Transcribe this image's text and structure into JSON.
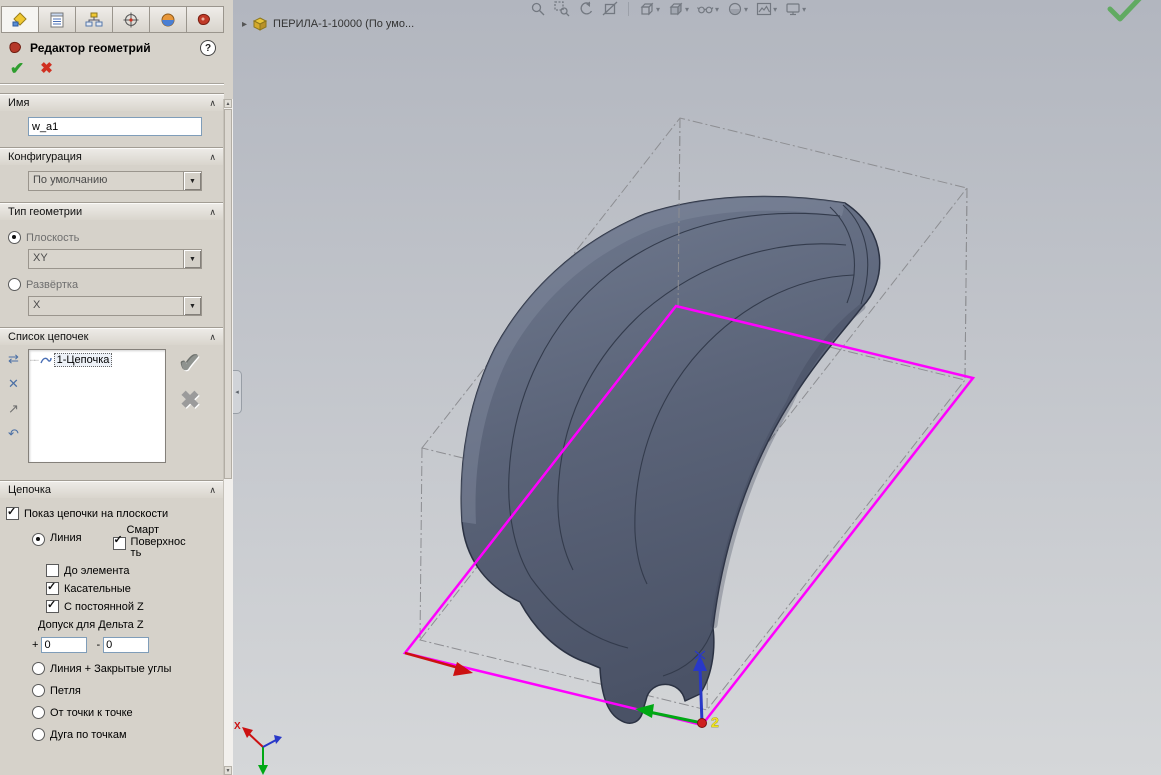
{
  "panel": {
    "icons": {
      "collapse": "∧",
      "dropdown": "▼",
      "hud_dropdown": "▾",
      "scroll_up": "▲",
      "scroll_down": "▼",
      "splitter": "◂",
      "tree_expand": "▸"
    },
    "header": {
      "title": "Редактор геометрий",
      "help_glyph": "?"
    },
    "actions": {
      "ok_glyph": "✔",
      "cancel_glyph": "✖"
    },
    "groups": {
      "name": {
        "label": "Имя",
        "value": "w_a1"
      },
      "configuration": {
        "label": "Конфигурация",
        "value": "По умолчанию"
      },
      "geometry_type": {
        "label": "Тип геометрии",
        "plane": {
          "label": "Плоскость",
          "value": "XY",
          "selected": true
        },
        "unfold": {
          "label": "Развёртка",
          "value": "X",
          "selected": false
        }
      },
      "chain_list": {
        "label": "Список цепочек",
        "items": [
          "1-Цепочка"
        ],
        "tool_glyphs": [
          "⇄",
          "✕",
          "↗",
          "↶"
        ],
        "ok_glyph": "✔",
        "delete_glyph": "✖"
      },
      "chain": {
        "label": "Цепочка",
        "show_on_plane": "Показ цепочки на плоскости",
        "show_on_plane_checked": true,
        "line": "Линия",
        "line_selected": true,
        "smart_label": "Смарт",
        "surface_label": "Поверхность",
        "smart_surface_checked": true,
        "to_element": "До элемента",
        "to_element_checked": false,
        "tangents": "Касательные",
        "tangents_checked": true,
        "constant_z": "С постоянной Z",
        "constant_z_checked": true,
        "delta_tolerance_label": "Допуск для Дельта Z",
        "plus_label": "+",
        "minus_label": "-",
        "plus_value": "0",
        "minus_value": "0",
        "line_closed_corners": "Линия + Закрытые углы",
        "loop": "Петля",
        "point_to_point": "От точки к точке",
        "arc_by_points": "Дуга по точкам"
      }
    }
  },
  "viewport": {
    "feature_tree_label": "ПЕРИЛА-1-10000  (По умо...",
    "origin_point_label": "2",
    "triad_x_label": "X",
    "colors": {
      "plane_outline": "#ff00ff",
      "part_fill": "#5b6377",
      "axis_x": "#cc1111",
      "axis_y": "#00a814",
      "axis_z": "#2838c8"
    }
  }
}
